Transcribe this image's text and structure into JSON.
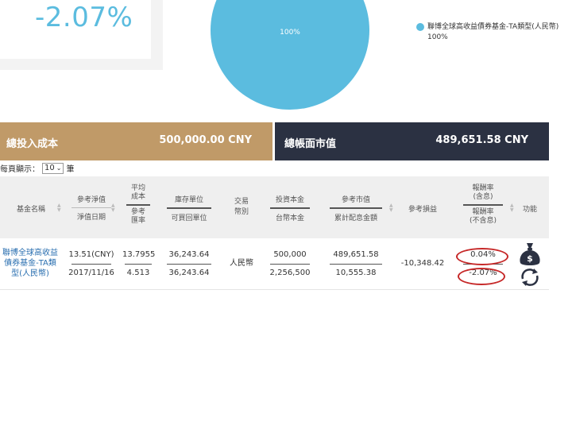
{
  "summary": {
    "return_rate": "-2.07%"
  },
  "pie_chart": {
    "slice_label": "100%",
    "legend": [
      {
        "label": "聯博全球高收益債券基金-TA類型(人民幣) 100%",
        "color": "#5bbcdf"
      }
    ]
  },
  "totals": {
    "cost_label": "總投入成本",
    "cost_value": "500,000.00  CNY",
    "market_label": "總帳面市值",
    "market_value": "489,651.58  CNY"
  },
  "pagination": {
    "prefix": "每頁顯示：",
    "value": "10",
    "suffix": "筆"
  },
  "table": {
    "headers": {
      "fund_name": "基金名稱",
      "nav": "參考淨值",
      "nav_date": "淨值日期",
      "avg_cost_1": "平均",
      "avg_cost_2": "成本",
      "ref_rate_1": "參考",
      "ref_rate_2": "匯率",
      "units": "庫存單位",
      "redeemable": "可買回單位",
      "currency_1": "交易",
      "currency_2": "幣別",
      "invest": "投資本金",
      "twd": "台幣本金",
      "mv": "參考市值",
      "div": "累計配息金額",
      "pnl": "參考損益",
      "ret_incl_1": "報酬率",
      "ret_incl_2": "(含息)",
      "ret_excl_1": "報酬率",
      "ret_excl_2": "(不含息)",
      "func": "功能"
    },
    "rows": [
      {
        "fund_name": "聯博全球高收益債券基金-TA類型(人民幣)",
        "nav": "13.51(CNY)",
        "nav_date": "2017/11/16",
        "avg_cost": "13.7955",
        "ref_rate": "4.513",
        "units": "36,243.64",
        "redeemable": "36,243.64",
        "currency": "人民幣",
        "invest": "500,000",
        "twd": "2,256,500",
        "mv": "489,651.58",
        "div": "10,555.38",
        "pnl": "-10,348.42",
        "ret_incl": "0.04%",
        "ret_excl": "-2.07%"
      }
    ]
  },
  "colors": {
    "accent": "#5bbcdf",
    "cost_bar": "#c09a68",
    "market_bar": "#2b3142",
    "annotation": "#c62828",
    "link": "#2a6fb0"
  },
  "icons": [
    "money-bag-icon",
    "redeem-cycle-icon"
  ]
}
